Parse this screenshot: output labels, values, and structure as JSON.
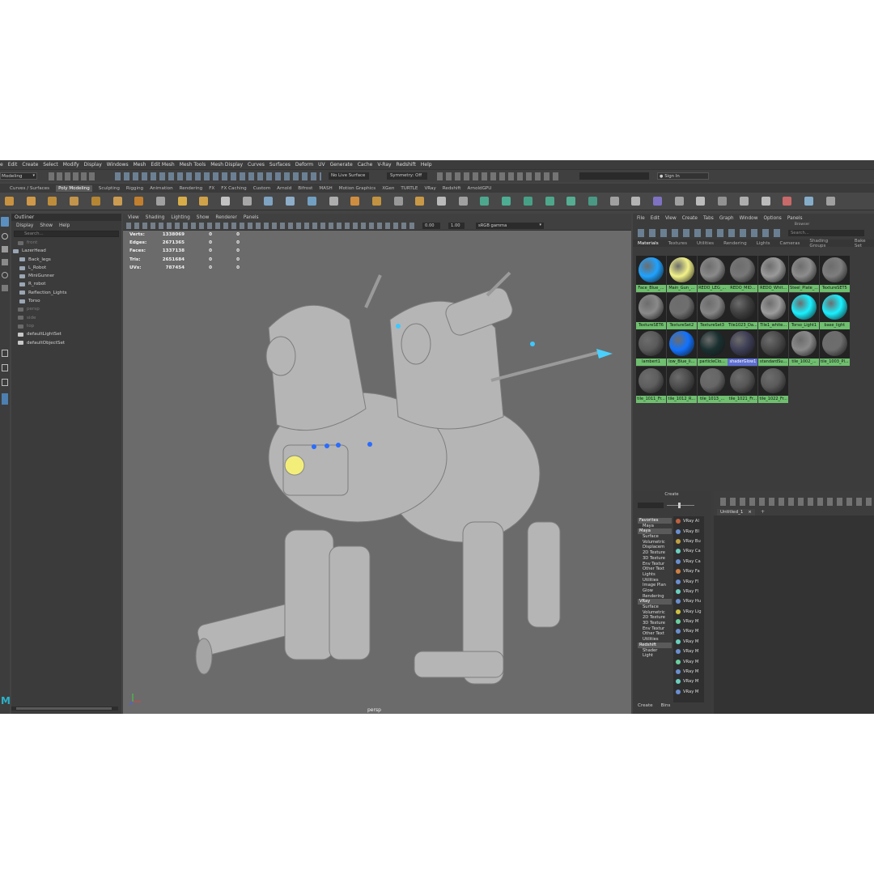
{
  "menubar": [
    "e",
    "Edit",
    "Create",
    "Select",
    "Modify",
    "Display",
    "Windows",
    "Mesh",
    "Edit Mesh",
    "Mesh Tools",
    "Mesh Display",
    "Curves",
    "Surfaces",
    "Deform",
    "UV",
    "Generate",
    "Cache",
    "V-Ray",
    "Redshift",
    "Help"
  ],
  "statusline": {
    "menuset": "Modeling",
    "surface": "No Live Surface",
    "symmetry": "Symmetry: Off",
    "signin": "Sign In"
  },
  "shelf_tabs": [
    "Curves / Surfaces",
    "Poly Modeling",
    "Sculpting",
    "Rigging",
    "Animation",
    "Rendering",
    "FX",
    "FX Caching",
    "Custom",
    "Arnold",
    "Bifrost",
    "MASH",
    "Motion Graphics",
    "XGen",
    "TURTLE",
    "VRay",
    "Redshift",
    "ArnoldGPU"
  ],
  "shelf_active": "Poly Modeling",
  "outliner": {
    "title": "Outliner",
    "menu": [
      "Display",
      "Show",
      "Help"
    ],
    "search": "Search...",
    "items": [
      "front",
      "LazerHead",
      "Back_legs",
      "L_Robot",
      "MiniGunner",
      "R_robot",
      "Reflection_Lights",
      "Torso",
      "persp",
      "side",
      "top",
      "defaultLightSet",
      "defaultObjectSet"
    ]
  },
  "viewport": {
    "menu": [
      "View",
      "Shading",
      "Lighting",
      "Show",
      "Renderer",
      "Panels"
    ],
    "near": "0.00",
    "far": "1.00",
    "colorspace": "sRGB gamma",
    "label": "persp",
    "hud": [
      {
        "label": "Verts:",
        "value": "1338069",
        "a": "0",
        "b": "0"
      },
      {
        "label": "Edges:",
        "value": "2671365",
        "a": "0",
        "b": "0"
      },
      {
        "label": "Faces:",
        "value": "1337138",
        "a": "0",
        "b": "0"
      },
      {
        "label": "Tris:",
        "value": "2651684",
        "a": "0",
        "b": "0"
      },
      {
        "label": "UVs:",
        "value": "787454",
        "a": "0",
        "b": "0"
      }
    ]
  },
  "hypershade": {
    "menu": [
      "File",
      "Edit",
      "View",
      "Create",
      "Tabs",
      "Graph",
      "Window",
      "Options",
      "Panels"
    ],
    "browser_title": "Browser",
    "search": "Search...",
    "tabs": [
      "Materials",
      "Textures",
      "Utilities",
      "Rendering",
      "Lights",
      "Cameras",
      "Shading Groups",
      "Bake Set"
    ],
    "materials": [
      {
        "name": "Face_Blue_...",
        "color": "#1fa2ff"
      },
      {
        "name": "Main_Gun_...",
        "color": "#f2f28a"
      },
      {
        "name": "REDO_LEG_...",
        "color": "#8a8a8a"
      },
      {
        "name": "REDO_MID...",
        "color": "#777777"
      },
      {
        "name": "REDO_Whit...",
        "color": "#9a9a9a"
      },
      {
        "name": "Steel_Plate_...",
        "color": "#8d8d8d"
      },
      {
        "name": "TextureSET5",
        "color": "#7e7e7e"
      },
      {
        "name": "TextureSET6",
        "color": "#8a8a8a"
      },
      {
        "name": "TextureSet2",
        "color": "#6f6f6f"
      },
      {
        "name": "TextureSet3",
        "color": "#858585"
      },
      {
        "name": "Tile1023_Da...",
        "color": "#3e3e3e"
      },
      {
        "name": "Tile1_white...",
        "color": "#9c9c9c"
      },
      {
        "name": "Torso_Light1",
        "color": "#19f0ff"
      },
      {
        "name": "base_light",
        "color": "#19f0ff"
      },
      {
        "name": "lambert1",
        "color": "#5a5a5a"
      },
      {
        "name": "low_Blue_li...",
        "color": "#1172ff"
      },
      {
        "name": "particleClo...",
        "color": "#1a3030"
      },
      {
        "name": "shaderGlow1",
        "color": "#3d3d55"
      },
      {
        "name": "standardSu...",
        "color": "#4a4a4a"
      },
      {
        "name": "tile_1002_...",
        "color": "#8a8a8a"
      },
      {
        "name": "tile_1003_Pl...",
        "color": "#6d6d6d"
      },
      {
        "name": "tile_1011_Fr...",
        "color": "#5e5e5e"
      },
      {
        "name": "tile_1012_R...",
        "color": "#4c4c4c"
      },
      {
        "name": "tile_1013_...",
        "color": "#666666"
      },
      {
        "name": "tile_1021_Fr...",
        "color": "#565656"
      },
      {
        "name": "tile_1022_Fr...",
        "color": "#5a5a5a"
      }
    ],
    "create_title": "Create",
    "categories": [
      {
        "label": "Favorites",
        "h": true
      },
      {
        "label": "Maya",
        "h": false
      },
      {
        "label": "Maya",
        "h": true
      },
      {
        "label": "Surface",
        "h": false
      },
      {
        "label": "Volumetric",
        "h": false
      },
      {
        "label": "Displacem",
        "h": false
      },
      {
        "label": "2D Texture",
        "h": false
      },
      {
        "label": "3D Texture",
        "h": false
      },
      {
        "label": "Env Textur",
        "h": false
      },
      {
        "label": "Other Text",
        "h": false
      },
      {
        "label": "Lights",
        "h": false
      },
      {
        "label": "Utilities",
        "h": false
      },
      {
        "label": "Image Plan",
        "h": false
      },
      {
        "label": "Glow",
        "h": false
      },
      {
        "label": "Rendering",
        "h": false
      },
      {
        "label": "VRay",
        "h": true
      },
      {
        "label": "Surface",
        "h": false
      },
      {
        "label": "Volumetric",
        "h": false
      },
      {
        "label": "2D Texture",
        "h": false
      },
      {
        "label": "3D Texture",
        "h": false
      },
      {
        "label": "Env Textur",
        "h": false
      },
      {
        "label": "Other Text",
        "h": false
      },
      {
        "label": "Utilities",
        "h": false
      },
      {
        "label": "Redshift",
        "h": true
      },
      {
        "label": "Shader",
        "h": false
      },
      {
        "label": "Light",
        "h": false
      }
    ],
    "nodes": [
      "VRay Al",
      "VRay Bl",
      "VRay Bu",
      "VRay Ca",
      "VRay Ca",
      "VRay Fa",
      "VRay Fl",
      "VRay Fl",
      "VRay Hu",
      "VRay Lig",
      "VRay M",
      "VRay M",
      "VRay M",
      "VRay M",
      "VRay M",
      "VRay M",
      "VRay M",
      "VRay M"
    ],
    "work_tab": "Untitled_1",
    "bottom_tabs": [
      "Create",
      "Bins"
    ]
  }
}
